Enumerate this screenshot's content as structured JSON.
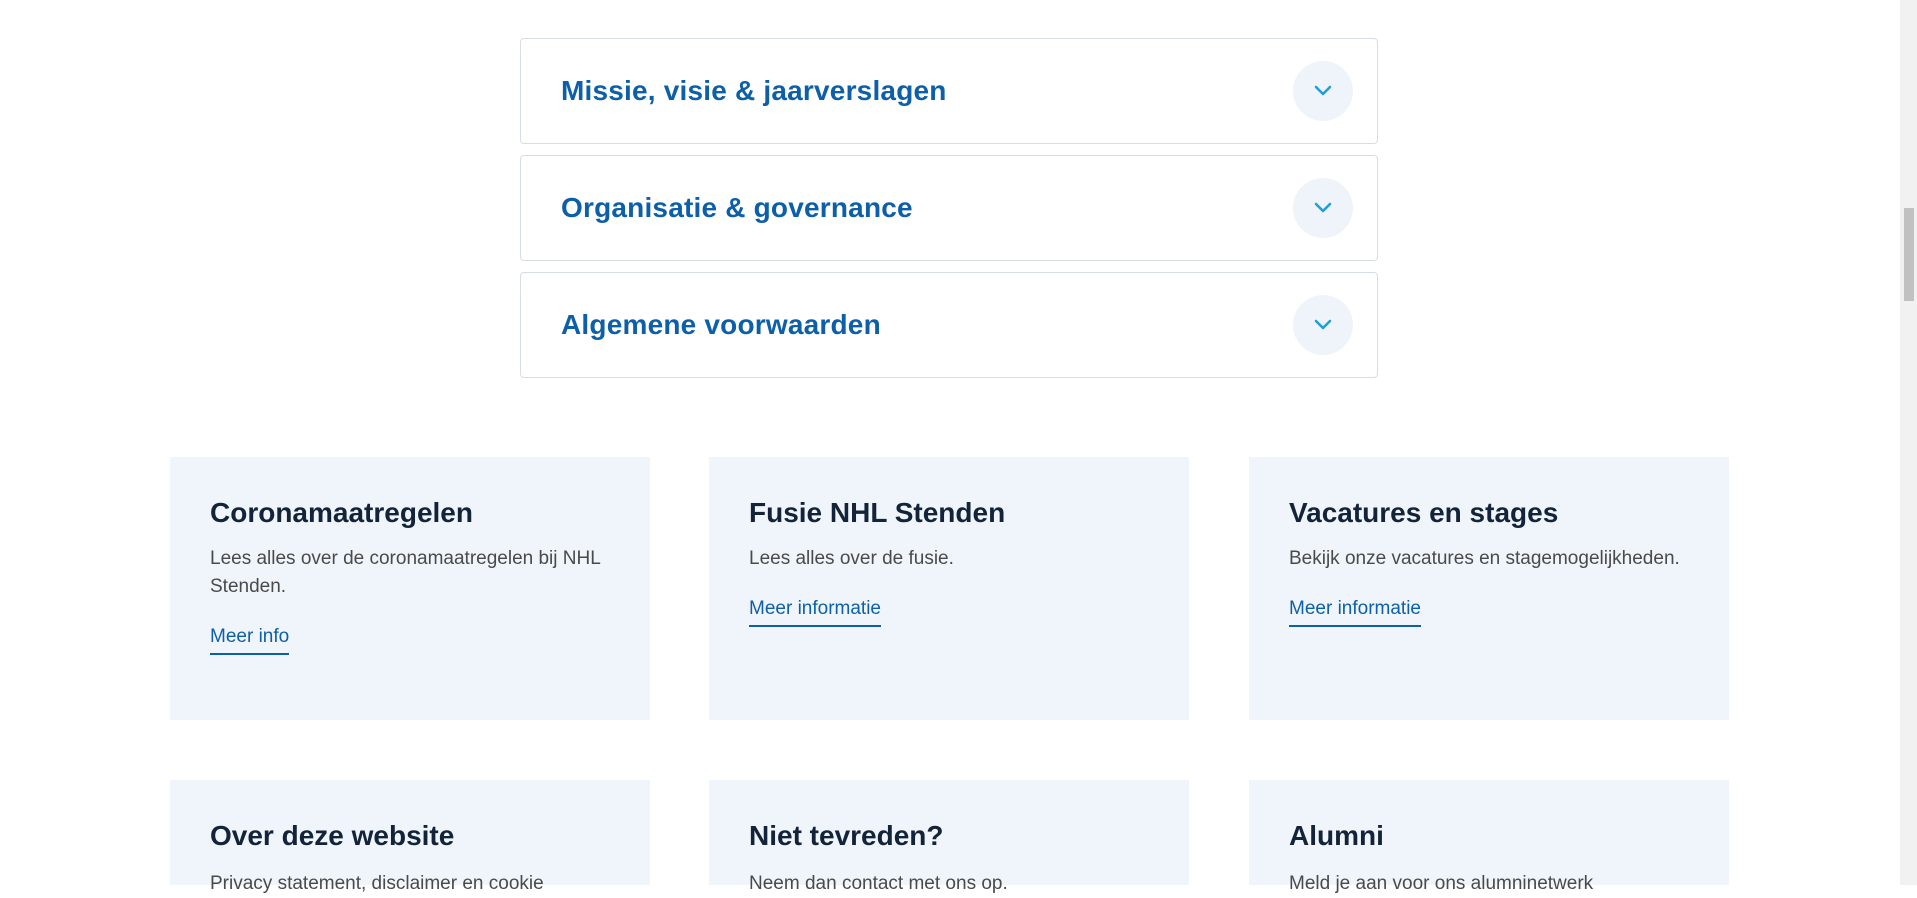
{
  "accordion": {
    "items": [
      {
        "title": "Missie, visie & jaarverslagen"
      },
      {
        "title": "Organisatie & governance"
      },
      {
        "title": "Algemene voorwaarden"
      }
    ]
  },
  "cards": [
    {
      "title": "Coronamaatregelen",
      "text": "Lees alles over de coronamaatregelen bij NHL Stenden.",
      "link": "Meer info"
    },
    {
      "title": "Fusie NHL Stenden",
      "text": "Lees alles over de fusie.",
      "link": "Meer informatie"
    },
    {
      "title": "Vacatures en stages",
      "text": "Bekijk onze vacatures en stagemogelijkheden.",
      "link": "Meer informatie"
    },
    {
      "title": "Over deze website",
      "text": "Privacy statement, disclaimer en cookie"
    },
    {
      "title": "Niet tevreden?",
      "text": "Neem dan contact met ons op."
    },
    {
      "title": "Alumni",
      "text": "Meld je aan voor ons alumninetwerk"
    }
  ],
  "icons": {
    "toggle": "chevron-down-icon"
  },
  "colors": {
    "accent": "#0d5fa8",
    "card_bg": "#eff5fa",
    "heading": "#13243a",
    "chevron": "#1fa0d8"
  }
}
